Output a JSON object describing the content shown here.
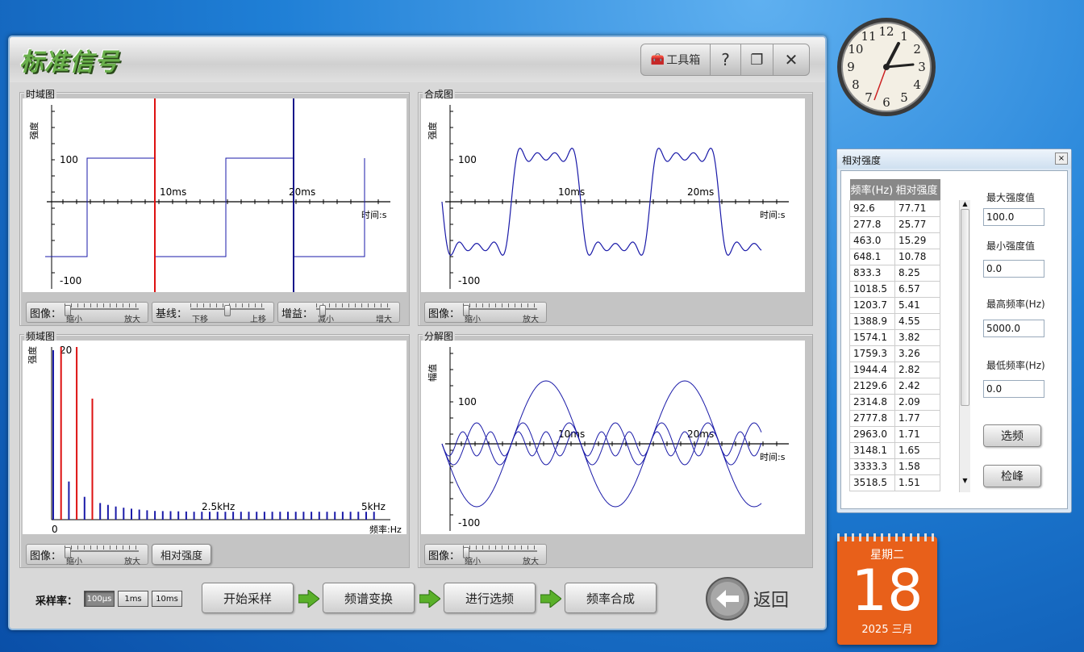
{
  "app": {
    "title": "标准信号",
    "toolbox": "工具箱",
    "help": "?"
  },
  "panels": {
    "time": {
      "title": "时域图",
      "ylabel": "强度",
      "y_top": "100",
      "y_bottom": "-100",
      "t10": "10ms",
      "t20": "20ms",
      "xunit": "时间:s"
    },
    "synth": {
      "title": "合成图",
      "ylabel": "强度",
      "y_top": "100",
      "y_bottom": "-100",
      "t10": "10ms",
      "t20": "20ms",
      "xunit": "时间:s"
    },
    "freq": {
      "title": "频域图",
      "ylabel": "强度",
      "y_top": "20",
      "x0": "0",
      "xmid": "2.5kHz",
      "xend": "5kHz",
      "xunit": "频率:Hz"
    },
    "decomp": {
      "title": "分解图",
      "ylabel": "幅值",
      "y_top": "100",
      "y_bottom": "-100",
      "t10": "10ms",
      "t20": "20ms",
      "xunit": "时间:s"
    }
  },
  "sliders": {
    "image": {
      "label": "图像：",
      "lo": "缩小",
      "hi": "放大"
    },
    "baseline": {
      "label": "基线：",
      "lo": "下移",
      "hi": "上移"
    },
    "gain": {
      "label": "增益：",
      "lo": "减小",
      "hi": "增大"
    }
  },
  "buttons": {
    "relative": "相对强度",
    "start": "开始采样",
    "fft": "频谱变换",
    "select": "进行选频",
    "synth": "频率合成",
    "back": "返回"
  },
  "sampling": {
    "label": "采样率：",
    "options": [
      "100μs",
      "1ms",
      "10ms"
    ],
    "selected": "100μs"
  },
  "side": {
    "title": "相对强度",
    "col_freq": "频率(Hz)",
    "col_rel": "相对强度",
    "rows": [
      [
        "92.6",
        "77.71"
      ],
      [
        "277.8",
        "25.77"
      ],
      [
        "463.0",
        "15.29"
      ],
      [
        "648.1",
        "10.78"
      ],
      [
        "833.3",
        "8.25"
      ],
      [
        "1018.5",
        "6.57"
      ],
      [
        "1203.7",
        "5.41"
      ],
      [
        "1388.9",
        "4.55"
      ],
      [
        "1574.1",
        "3.82"
      ],
      [
        "1759.3",
        "3.26"
      ],
      [
        "1944.4",
        "2.82"
      ],
      [
        "2129.6",
        "2.42"
      ],
      [
        "2314.8",
        "2.09"
      ],
      [
        "2777.8",
        "1.77"
      ],
      [
        "2963.0",
        "1.71"
      ],
      [
        "3148.1",
        "1.65"
      ],
      [
        "3333.3",
        "1.58"
      ],
      [
        "3518.5",
        "1.51"
      ]
    ],
    "max_label": "最大强度值",
    "max_val": "100.0",
    "min_label": "最小强度值",
    "min_val": "0.0",
    "fmax_label": "最高频率(Hz)",
    "fmax_val": "5000.0",
    "fmin_label": "最低频率(Hz)",
    "fmin_val": "0.0",
    "btn_select": "选频",
    "btn_peak": "检峰"
  },
  "calendar": {
    "weekday": "星期二",
    "day": "18",
    "yearmonth": "2025 三月"
  },
  "clock": {
    "numerals": [
      "12",
      "1",
      "2",
      "3",
      "4",
      "5",
      "6",
      "7",
      "8",
      "9",
      "10",
      "11"
    ]
  },
  "colors": {
    "signal": "#1a1aa8",
    "marker_red": "#d11",
    "marker_blue": "#14148a",
    "calendar": "#e8601a"
  }
}
